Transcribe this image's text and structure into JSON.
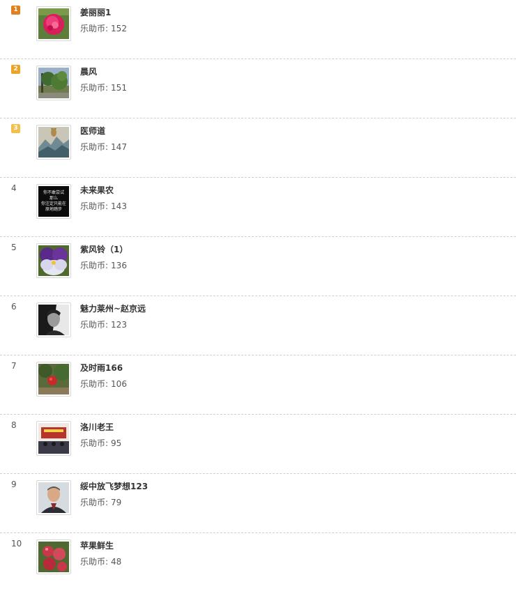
{
  "coin_label": "乐助币:",
  "rows": [
    {
      "rank": "1",
      "name": "姜丽丽1",
      "coins": "152",
      "badge": true,
      "avatar_icon": "peony-flower-avatar"
    },
    {
      "rank": "2",
      "name": "晨风",
      "coins": "151",
      "badge": true,
      "avatar_icon": "garden-tree-avatar"
    },
    {
      "rank": "3",
      "name": "医师道",
      "coins": "147",
      "badge": true,
      "avatar_icon": "landscape-vase-avatar"
    },
    {
      "rank": "4",
      "name": "未来果农",
      "coins": "143",
      "badge": false,
      "avatar_icon": "black-text-avatar",
      "avatar_text": [
        "你不敢尝试",
        "那么",
        "你注定只能在",
        "原地踏步"
      ]
    },
    {
      "rank": "5",
      "name": "紫风铃（1）",
      "coins": "136",
      "badge": false,
      "avatar_icon": "pansy-flower-avatar"
    },
    {
      "rank": "6",
      "name": "魅力莱州~赵京远",
      "coins": "123",
      "badge": false,
      "avatar_icon": "bw-portrait-avatar"
    },
    {
      "rank": "7",
      "name": "及时雨166",
      "coins": "106",
      "badge": false,
      "avatar_icon": "pomegranate-tree-avatar"
    },
    {
      "rank": "8",
      "name": "洛川老王",
      "coins": "95",
      "badge": false,
      "avatar_icon": "meeting-hall-avatar"
    },
    {
      "rank": "9",
      "name": "绥中放飞梦想123",
      "coins": "79",
      "badge": false,
      "avatar_icon": "man-portrait-avatar"
    },
    {
      "rank": "10",
      "name": "苹果鲜生",
      "coins": "48",
      "badge": false,
      "avatar_icon": "apples-avatar"
    }
  ]
}
